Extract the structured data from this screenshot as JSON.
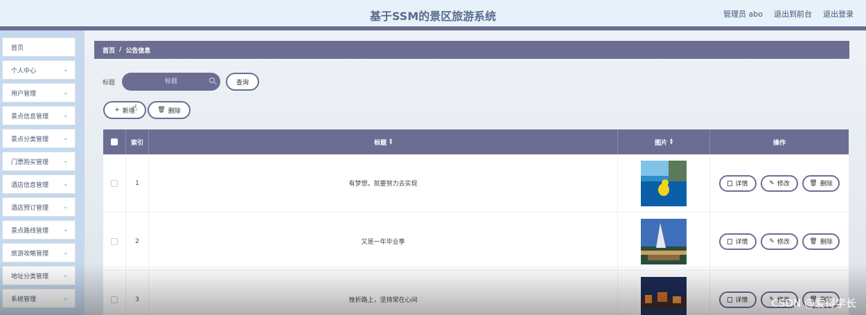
{
  "header": {
    "title": "基于SSM的景区旅游系统",
    "user": "管理员 abo",
    "exit_front": "退出到前台",
    "logout": "退出登录"
  },
  "sidebar": {
    "items": [
      {
        "label": "首页",
        "chevron": false
      },
      {
        "label": "个人中心",
        "chevron": true
      },
      {
        "label": "用户管理",
        "chevron": true
      },
      {
        "label": "景点信息管理",
        "chevron": true
      },
      {
        "label": "景点分类管理",
        "chevron": true
      },
      {
        "label": "门票购买管理",
        "chevron": true
      },
      {
        "label": "酒店信息管理",
        "chevron": true
      },
      {
        "label": "酒店预订管理",
        "chevron": true
      },
      {
        "label": "景点路线管理",
        "chevron": true
      },
      {
        "label": "旅游攻略管理",
        "chevron": true
      },
      {
        "label": "地址分类管理",
        "chevron": true
      },
      {
        "label": "系统管理",
        "chevron": true
      }
    ]
  },
  "breadcrumb": {
    "home": "首页",
    "separator": "/",
    "current": "公告信息"
  },
  "search": {
    "label": "标题",
    "placeholder": "标题",
    "button": "查询"
  },
  "actions": {
    "add": "新增",
    "delete": "删除"
  },
  "table": {
    "columns": {
      "index": "索引",
      "title": "标题",
      "image": "图片",
      "operation": "操作"
    },
    "rows": [
      {
        "index": "1",
        "title": "有梦想，就要努力去实现",
        "image": "duck-pool-image"
      },
      {
        "index": "2",
        "title": "又是一年毕业季",
        "image": "sail-hotel-image"
      },
      {
        "index": "3",
        "title": "挫折路上，坚持常在心间",
        "image": "night-town-image"
      }
    ],
    "op_labels": {
      "detail": "详情",
      "edit": "修改",
      "delete": "删除"
    }
  },
  "watermark": "CSDN @爱得学长",
  "colors": {
    "primary": "#6b6d93",
    "header_bg": "#e6f1f9",
    "sidebar_bg": "#c5d8ec"
  }
}
